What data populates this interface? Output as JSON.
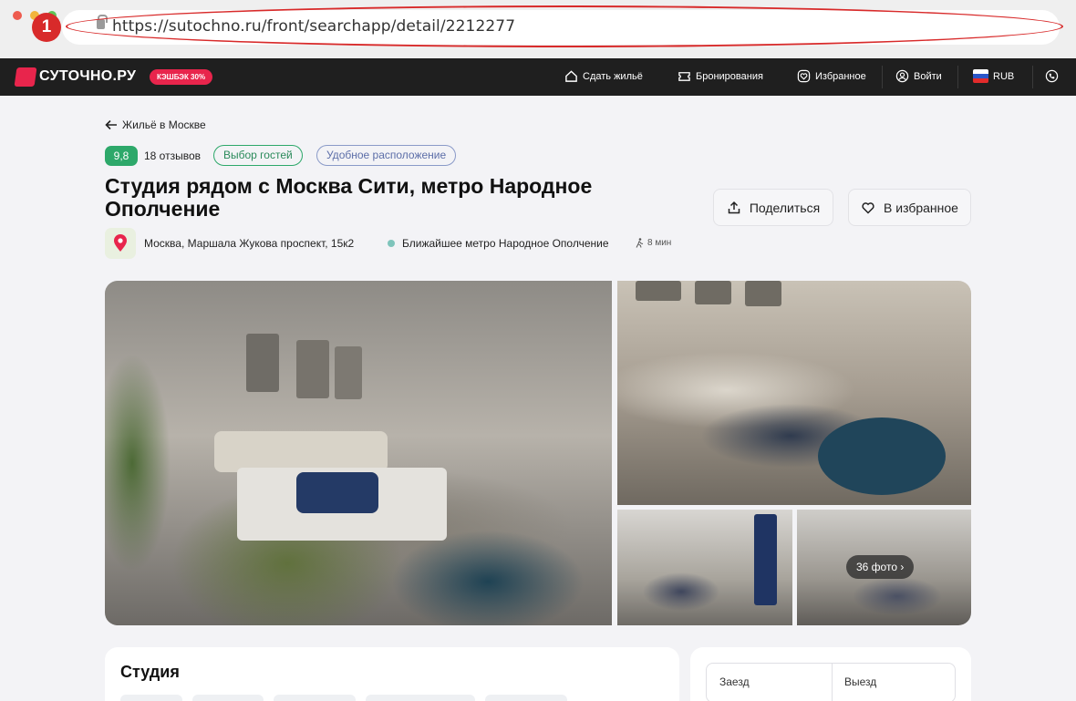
{
  "browser": {
    "url": "https://sutochno.ru/front/searchapp/detail/2212277",
    "annotation_number": "1"
  },
  "header": {
    "logo_text": "СУТОЧНО.РУ",
    "cashback_label": "КЭШБЭК 30%",
    "nav": {
      "rent_out": "Сдать жильё",
      "bookings": "Бронирования",
      "favorites": "Избранное",
      "login": "Войти",
      "currency": "RUB"
    }
  },
  "listing": {
    "back_link": "Жильё в Москве",
    "rating": "9,8",
    "reviews": "18 отзывов",
    "tags": [
      "Выбор гостей",
      "Удобное расположение"
    ],
    "title": "Студия рядом с Москва Сити, метро Народное Ополчение",
    "share_label": "Поделиться",
    "favorite_label": "В избранное",
    "address": "Москва, Маршала Жукова проспект, 15к2",
    "metro": "Ближайшее метро Народное Ополчение",
    "walk_time": "8 мин",
    "photos_count_label": "36 фото"
  },
  "details": {
    "section_title": "Студия"
  },
  "booking": {
    "checkin_label": "Заезд",
    "checkout_label": "Выезд"
  },
  "colors": {
    "brand_red": "#e8254c",
    "rating_green": "#2da86a",
    "annotation_red": "#d82a2a"
  }
}
